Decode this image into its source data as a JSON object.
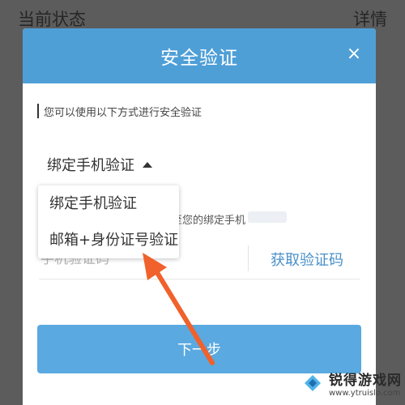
{
  "background": {
    "left_text": "当前状态",
    "right_text": "详情"
  },
  "modal": {
    "title": "安全验证",
    "close_glyph": "×",
    "description": "您可以使用以下方式进行安全验证",
    "selected_method": "绑定手机验证",
    "phone_hint": "至您的绑定手机",
    "code_placeholder": "手机验证码",
    "get_code_label": "获取验证码",
    "next_label": "下一步"
  },
  "dropdown": {
    "options": [
      "绑定手机验证",
      "邮箱+身份证号验证"
    ]
  },
  "watermark": {
    "name": "锐得游戏网",
    "url": "www.ytruislo.com"
  },
  "colors": {
    "header_blue": "#4f9fd7",
    "button_blue": "#5aa9e0",
    "link_blue": "#4a90c8",
    "arrow_orange": "#f0612b",
    "overlay": "#5c5c5c"
  },
  "icons": [
    "close-icon",
    "caret-up-icon",
    "arrow-pointer-icon",
    "logo-icon"
  ]
}
